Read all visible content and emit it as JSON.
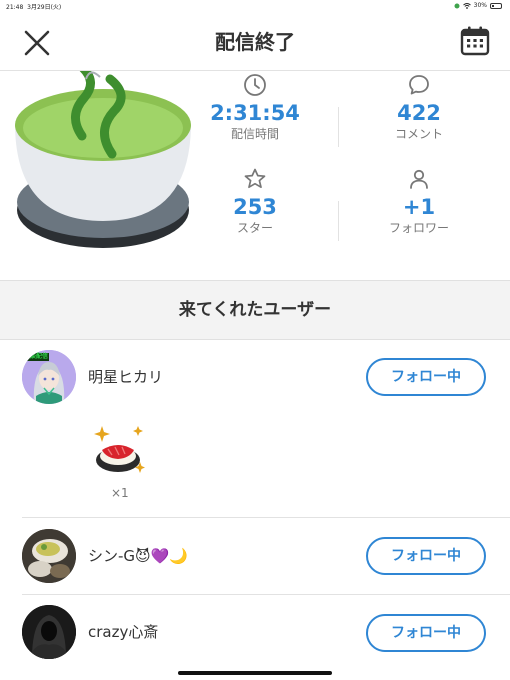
{
  "status_bar": {
    "time": "21:48",
    "date": "3月29日(火)",
    "battery": "30%",
    "battery_level": 0.3
  },
  "nav": {
    "title": "配信終了",
    "close_icon": "close-icon",
    "calendar_icon": "calendar-icon"
  },
  "stats": {
    "duration": {
      "icon": "clock-icon",
      "value": "2:31:54",
      "label": "配信時間"
    },
    "comments": {
      "icon": "comment-icon",
      "value": "422",
      "label": "コメント"
    },
    "stars": {
      "icon": "star-icon",
      "value": "253",
      "label": "スター"
    },
    "followers": {
      "icon": "person-icon",
      "value": "+1",
      "label": "フォロワー"
    }
  },
  "illustration": {
    "icon": "tea-bowl-icon"
  },
  "section": {
    "title": "来てくれたユーザー"
  },
  "users": [
    {
      "name": "明星ヒカリ",
      "follow_label": "フォロー中",
      "avatar_badge": "雑談配信",
      "gift": {
        "icon": "sushi-icon",
        "count": "×1"
      }
    },
    {
      "name": "シン-G😈💜🌙",
      "follow_label": "フォロー中"
    },
    {
      "name": "crazy心斎",
      "follow_label": "フォロー中"
    }
  ],
  "colors": {
    "accent": "#2f86d4",
    "divider": "#e2e2e2",
    "band": "#f3f3f3"
  }
}
